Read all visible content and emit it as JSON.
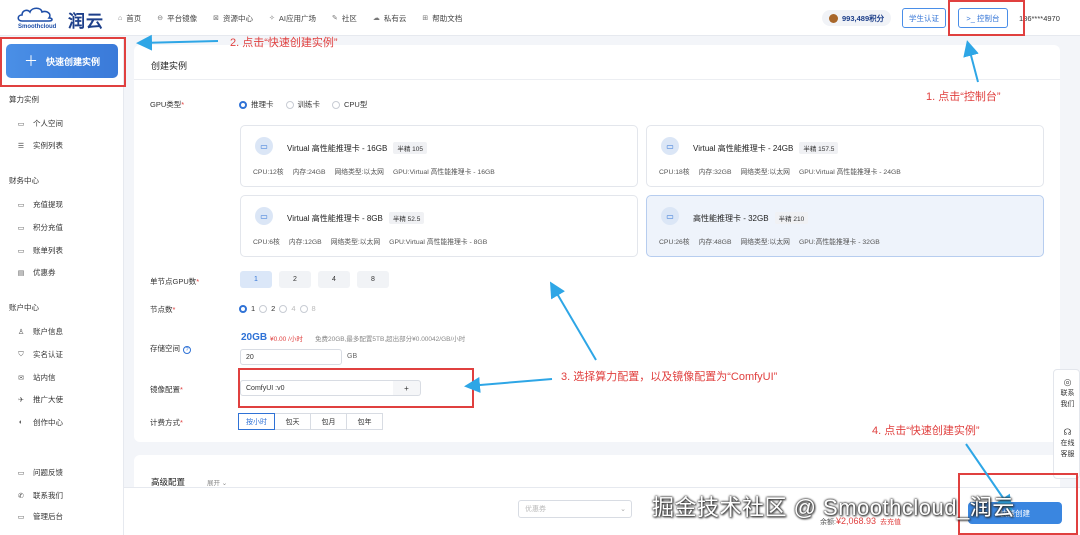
{
  "brand": {
    "en": "Smoothcloud",
    "cn": "润云"
  },
  "nav": [
    {
      "icon": "⌂",
      "label": "首页"
    },
    {
      "icon": "⊖",
      "label": "平台镜像"
    },
    {
      "icon": "⊠",
      "label": "资源中心"
    },
    {
      "icon": "✧",
      "label": "AI应用广场"
    },
    {
      "icon": "✎",
      "label": "社区"
    },
    {
      "icon": "☁",
      "label": "私有云"
    },
    {
      "icon": "⊞",
      "label": "帮助文档"
    }
  ],
  "header": {
    "points": "993,489积分",
    "student": "学生认证",
    "console": ">_ 控制台",
    "phone": "186****4970"
  },
  "sidebar": {
    "quick_create": "快速创建实例",
    "sections": [
      {
        "title": "算力实例",
        "items": [
          {
            "icon": "▭",
            "label": "个人空间"
          },
          {
            "icon": "☰",
            "label": "实例列表"
          }
        ]
      },
      {
        "title": "财务中心",
        "items": [
          {
            "icon": "▭",
            "label": "充值提现"
          },
          {
            "icon": "▭",
            "label": "积分充值"
          },
          {
            "icon": "▭",
            "label": "账单列表"
          },
          {
            "icon": "▤",
            "label": "优惠券"
          }
        ]
      },
      {
        "title": "账户中心",
        "items": [
          {
            "icon": "♙",
            "label": "账户信息"
          },
          {
            "icon": "⛉",
            "label": "实名认证"
          },
          {
            "icon": "✉",
            "label": "站内信"
          },
          {
            "icon": "✈",
            "label": "推广大使"
          },
          {
            "icon": "◐",
            "label": "创作中心"
          }
        ]
      }
    ],
    "bottom": [
      {
        "icon": "▭",
        "label": "问题反馈"
      },
      {
        "icon": "✆",
        "label": "联系我们"
      },
      {
        "icon": "▭",
        "label": "管理后台"
      }
    ]
  },
  "form": {
    "title": "创建实例",
    "gpu_type_label": "GPU类型",
    "gpu_types": [
      "推理卡",
      "训练卡",
      "CPU型"
    ],
    "cards": [
      {
        "name": "Virtual 高性能推理卡 - 16GB",
        "badge": "半精 105",
        "cpu": "CPU:12核",
        "mem": "内存:24GB",
        "net": "网络类型:以太网",
        "gpu": "GPU:Virtual 高性能推理卡 - 16GB"
      },
      {
        "name": "Virtual 高性能推理卡 - 24GB",
        "badge": "半精 157.5",
        "cpu": "CPU:18核",
        "mem": "内存:32GB",
        "net": "网络类型:以太网",
        "gpu": "GPU:Virtual 高性能推理卡 - 24GB"
      },
      {
        "name": "Virtual 高性能推理卡 - 8GB",
        "badge": "半精 52.5",
        "cpu": "CPU:6核",
        "mem": "内存:12GB",
        "net": "网络类型:以太网",
        "gpu": "GPU:Virtual 高性能推理卡 - 8GB"
      },
      {
        "name": "高性能推理卡 - 32GB",
        "badge": "半精 210",
        "cpu": "CPU:26核",
        "mem": "内存:48GB",
        "net": "网络类型:以太网",
        "gpu": "GPU:高性能推理卡 - 32GB"
      }
    ],
    "gpu_count_label": "单节点GPU数",
    "gpu_counts": [
      "1",
      "2",
      "4",
      "8"
    ],
    "nodes_label": "节点数",
    "nodes": [
      "1",
      "2",
      "4",
      "8"
    ],
    "storage_label": "存储空间",
    "storage_size": "20GB",
    "storage_price": "¥0.00 /小时",
    "storage_note": "免费20GB,最多配置5TB,超出部分¥0.00042/GB/小时",
    "storage_value": "20",
    "storage_unit": "GB",
    "image_label": "镜像配置",
    "image_value": "ComfyUI :v0",
    "image_plus": "+",
    "billing_label": "计费方式",
    "billing": [
      "按小时",
      "包天",
      "包月",
      "包年"
    ]
  },
  "advanced": {
    "title": "高级配置",
    "expand": "展开"
  },
  "bottom": {
    "coupon": "优惠券",
    "balance_label": "余额:",
    "balance": "¥2,068.93",
    "recharge": "去充值",
    "create": "快速创建"
  },
  "float": {
    "contact": "联系我们",
    "online": "在线客服"
  },
  "annotations": {
    "a1": "1. 点击“控制台”",
    "a2": "2. 点击“快速创建实例”",
    "a3": "3. 选择算力配置，以及镜像配置为“ComfyUI”",
    "a4": "4. 点击“快速创建实例”"
  },
  "watermark": "掘金技术社区 @ Smoothcloud_润云",
  "colors": {
    "accent": "#2f72d6",
    "annotation": "#e0403f",
    "brand": "#1d3f8a"
  }
}
